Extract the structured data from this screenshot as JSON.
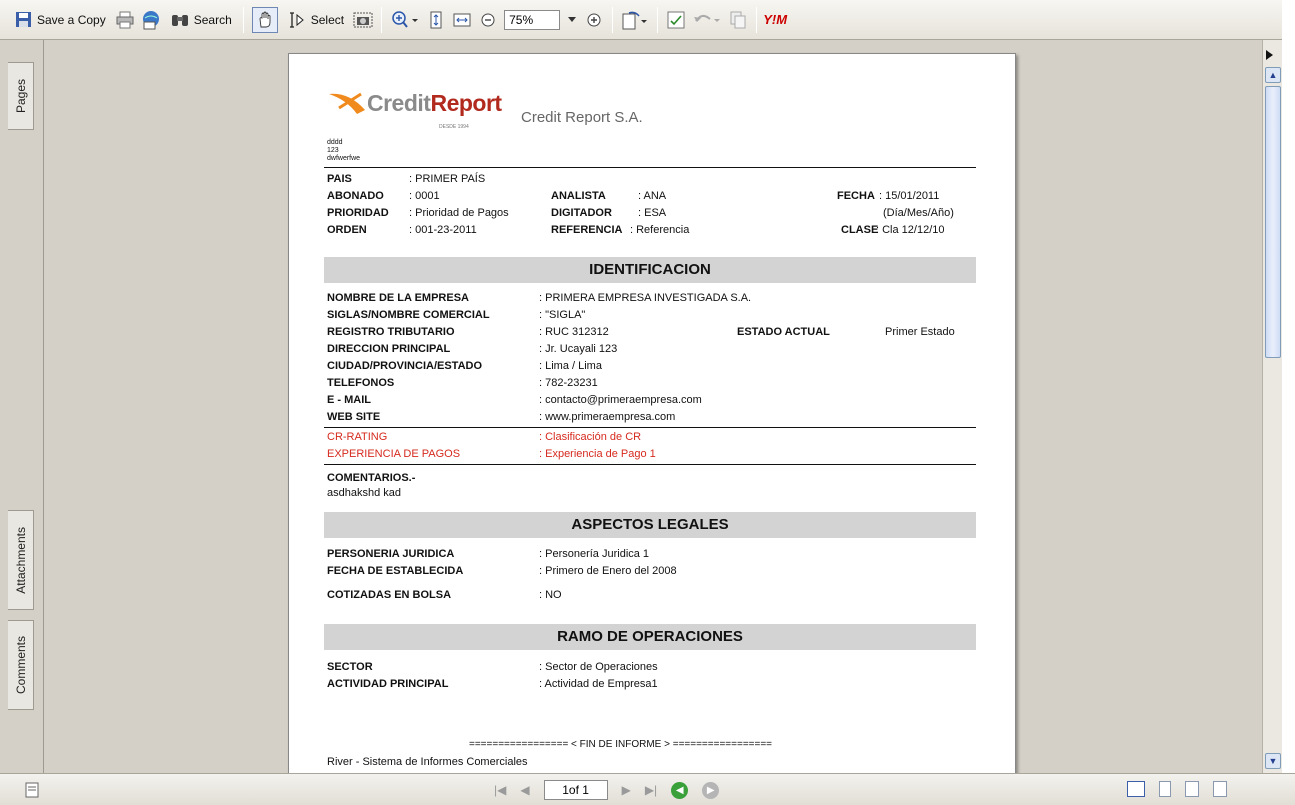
{
  "toolbar": {
    "save_copy": "Save a Copy",
    "search": "Search",
    "select": "Select",
    "zoom": "75%"
  },
  "sidebar": {
    "tabs": [
      "Pages",
      "Attachments",
      "Comments"
    ]
  },
  "status": {
    "page_indicator": "1of 1"
  },
  "report": {
    "logo_text_a": "Credit",
    "logo_text_b": "Report",
    "logo_since": "DESDE 1994",
    "company_name": "Credit Report S.A.",
    "small_lines": [
      "dddd",
      "123",
      "dwfwerfwe"
    ],
    "header": {
      "pais_label": "PAIS",
      "pais_value": ": PRIMER PAÍS",
      "abonado_label": "ABONADO",
      "abonado_value": ": 0001",
      "prioridad_label": "PRIORIDAD",
      "prioridad_value": ": Prioridad de Pagos",
      "orden_label": "ORDEN",
      "orden_value": ": 001-23-2011",
      "analista_label": "ANALISTA",
      "analista_value": ": ANA",
      "digitador_label": "DIGITADOR",
      "digitador_value": ": ESA",
      "referencia_label": "REFERENCIA",
      "referencia_value": ": Referencia",
      "fecha_label": "FECHA",
      "fecha_value": ": 15/01/2011",
      "fecha_format": "(Día/Mes/Año)",
      "clase_label": "CLASE",
      "clase_value": ": Cla  12/12/10"
    },
    "identificacion": {
      "title": "IDENTIFICACION",
      "rows": [
        {
          "label": "NOMBRE DE LA EMPRESA",
          "value": ": PRIMERA EMPRESA INVESTIGADA S.A."
        },
        {
          "label": "SIGLAS/NOMBRE COMERCIAL",
          "value": ": \"SIGLA\""
        },
        {
          "label": "REGISTRO TRIBUTARIO",
          "value": ": RUC 312312"
        },
        {
          "label": "DIRECCION PRINCIPAL",
          "value": ": Jr. Ucayali 123"
        },
        {
          "label": "CIUDAD/PROVINCIA/ESTADO",
          "value": ": Lima / Lima"
        },
        {
          "label": "TELEFONOS",
          "value": ": 782-23231"
        },
        {
          "label": "E - MAIL",
          "value": ": contacto@primeraempresa.com"
        },
        {
          "label": "WEB SITE",
          "value": ": www.primeraempresa.com"
        }
      ],
      "estado_label": "ESTADO ACTUAL",
      "estado_value": "Primer Estado",
      "cr_rating_label": "CR-RATING",
      "cr_rating_value": ": Clasificación de CR",
      "experiencia_label": "EXPERIENCIA DE PAGOS",
      "experiencia_value": ": Experiencia de Pago 1",
      "comentarios_label": "COMENTARIOS.-",
      "comentarios_value": "asdhakshd kad"
    },
    "aspectos": {
      "title": "ASPECTOS LEGALES",
      "rows": [
        {
          "label": "PERSONERIA JURIDICA",
          "value": ": Personería Juridica 1"
        },
        {
          "label": "FECHA DE ESTABLECIDA",
          "value": ": Primero de Enero del 2008"
        },
        {
          "label": "COTIZADAS EN BOLSA",
          "value": ": NO"
        }
      ]
    },
    "ramo": {
      "title": "RAMO DE OPERACIONES",
      "rows": [
        {
          "label": "SECTOR",
          "value": ": Sector de Operaciones"
        },
        {
          "label": "ACTIVIDAD PRINCIPAL",
          "value": ": Actividad de Empresa1"
        }
      ]
    },
    "fin": "================= < FIN DE INFORME > =================",
    "footer": "River - Sistema de Informes Comerciales"
  }
}
